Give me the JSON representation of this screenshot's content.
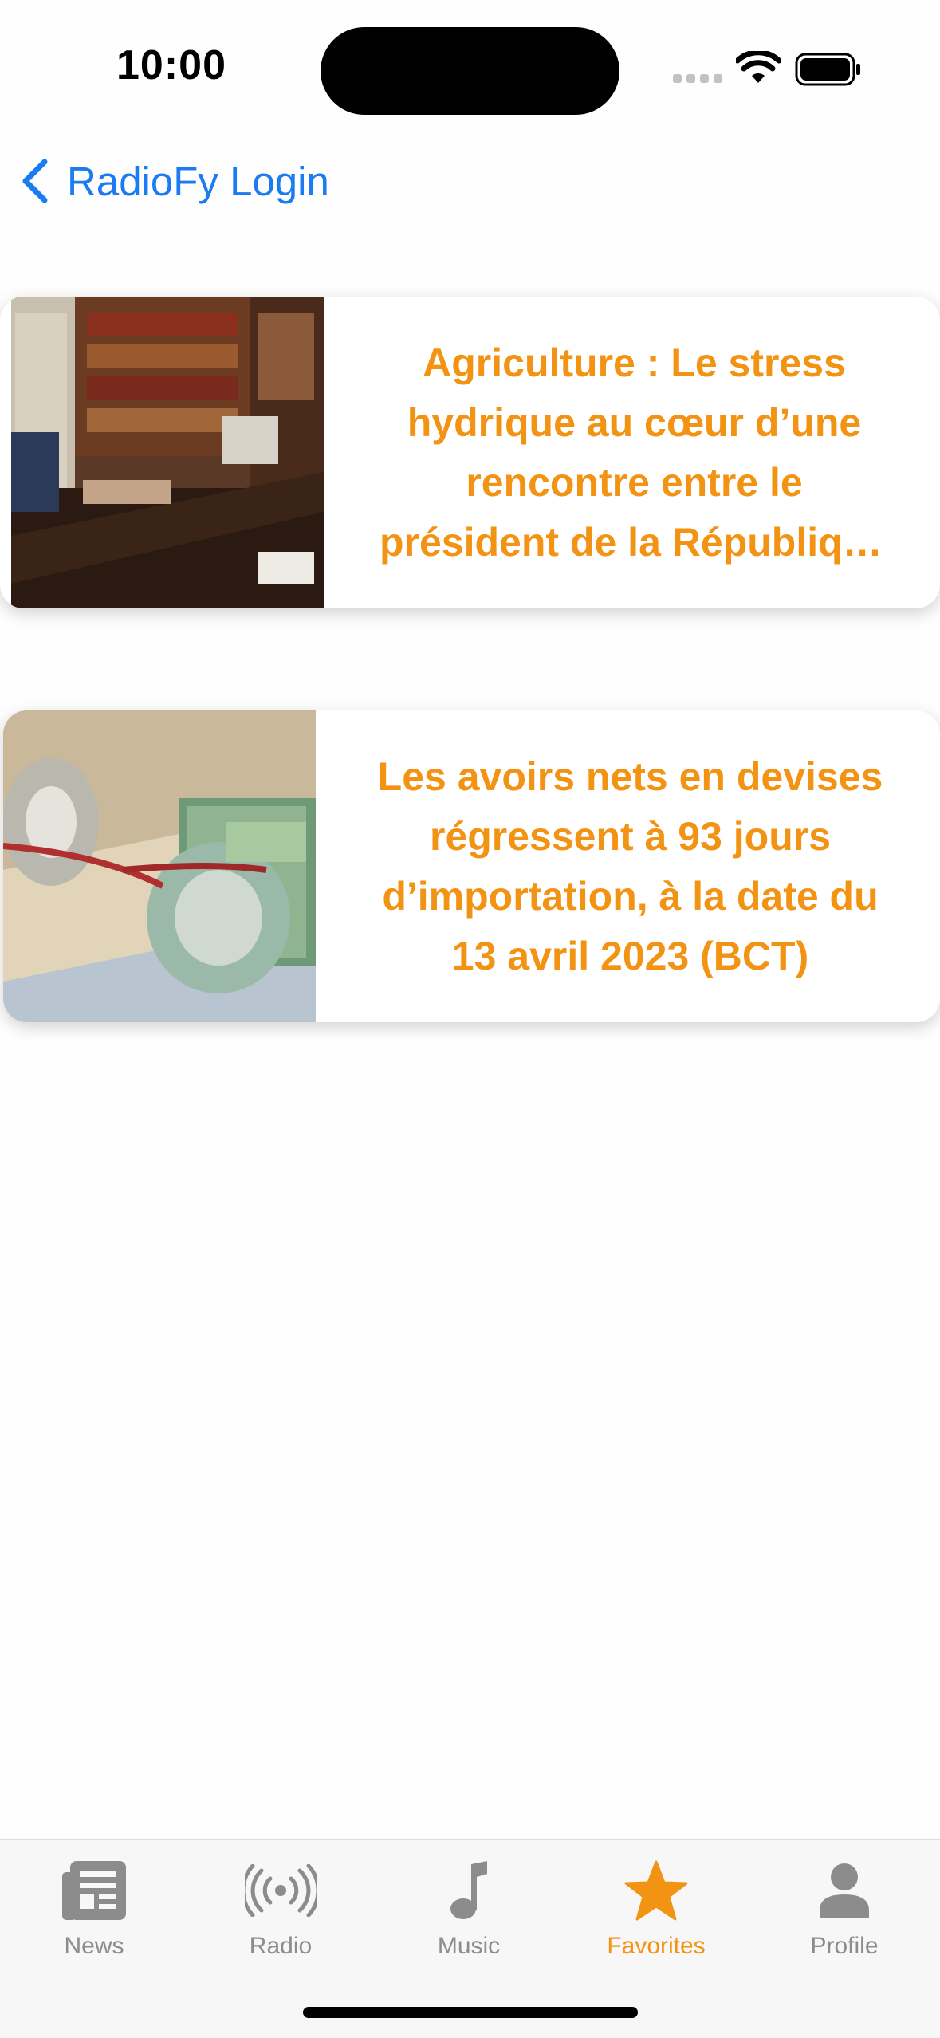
{
  "status_bar": {
    "time": "10:00"
  },
  "nav": {
    "back_label": "RadioFy Login"
  },
  "articles": [
    {
      "title": "Agriculture : Le stress hydrique au cœur d’une rencontre entre le président de la République avec le ministre de l’Agriculture",
      "image": "office-desk-photo"
    },
    {
      "title": "Les avoirs nets en devises régressent à 93 jours d’importation, à la date du 13 avril 2023 (BCT)",
      "image": "euro-banknotes-photo"
    }
  ],
  "tabs": [
    {
      "label": "News",
      "icon": "newspaper-icon",
      "active": false
    },
    {
      "label": "Radio",
      "icon": "radio-waves-icon",
      "active": false
    },
    {
      "label": "Music",
      "icon": "music-note-icon",
      "active": false
    },
    {
      "label": "Favorites",
      "icon": "star-icon",
      "active": true
    },
    {
      "label": "Profile",
      "icon": "person-icon",
      "active": false
    }
  ],
  "colors": {
    "accent": "#f39313",
    "link": "#1a7cf0",
    "inactive_tab": "#8c8c8c"
  }
}
